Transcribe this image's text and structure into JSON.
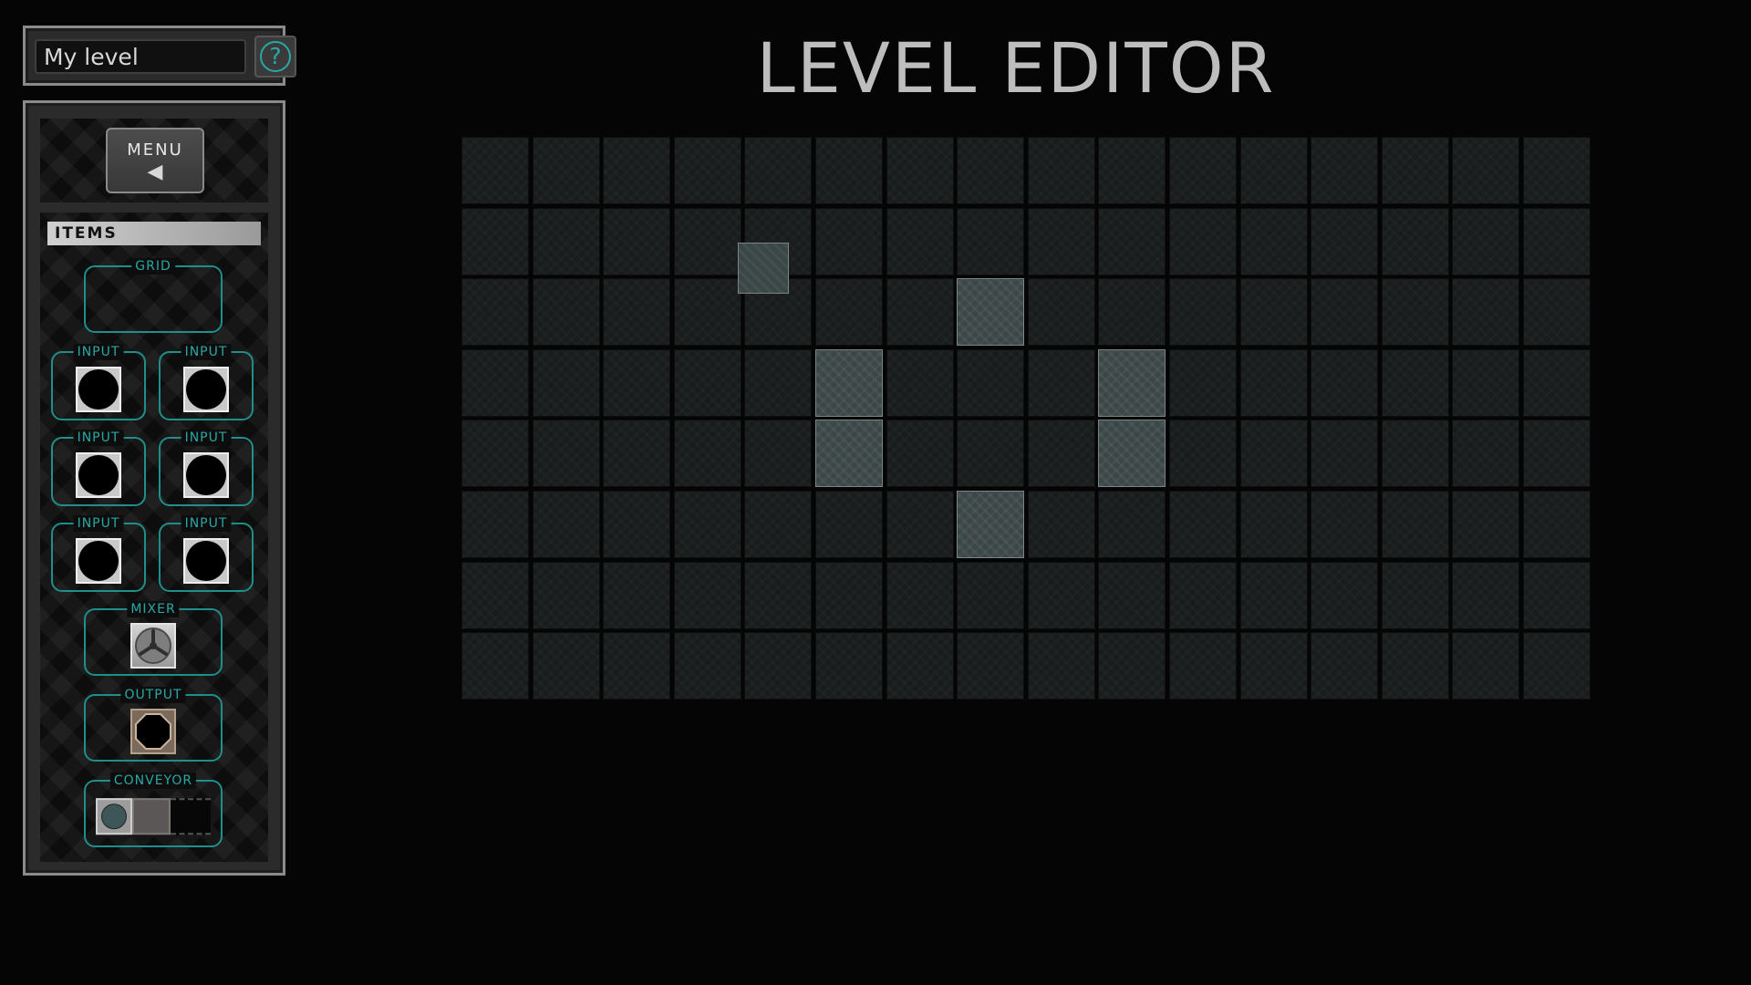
{
  "level_name": {
    "value": "My level",
    "placeholder": ""
  },
  "help_button": {
    "glyph": "?"
  },
  "title": "LEVEL EDITOR",
  "menu": {
    "label": "MENU",
    "arrow_glyph": "◀"
  },
  "items_panel": {
    "header": "ITEMS",
    "items": [
      {
        "key": "grid",
        "label": "GRID"
      },
      {
        "key": "input1",
        "label": "INPUT"
      },
      {
        "key": "input2",
        "label": "INPUT"
      },
      {
        "key": "input3",
        "label": "INPUT"
      },
      {
        "key": "input4",
        "label": "INPUT"
      },
      {
        "key": "input5",
        "label": "INPUT"
      },
      {
        "key": "input6",
        "label": "INPUT"
      },
      {
        "key": "mixer",
        "label": "MIXER"
      },
      {
        "key": "output",
        "label": "OUTPUT"
      },
      {
        "key": "conveyor",
        "label": "CONVEYOR"
      }
    ]
  },
  "grid": {
    "columns": 16,
    "rows": 8,
    "filled_cells": [
      {
        "row": 2,
        "col": 7
      },
      {
        "row": 3,
        "col": 5
      },
      {
        "row": 3,
        "col": 9
      },
      {
        "row": 4,
        "col": 5
      },
      {
        "row": 4,
        "col": 9
      },
      {
        "row": 5,
        "col": 7
      }
    ],
    "placed_tile": {
      "row": 1,
      "col": 4
    }
  },
  "colors": {
    "accent": "#2aa8a4",
    "background": "#050505",
    "cell": "#191c1c",
    "cell_filled": "#3b4646"
  }
}
